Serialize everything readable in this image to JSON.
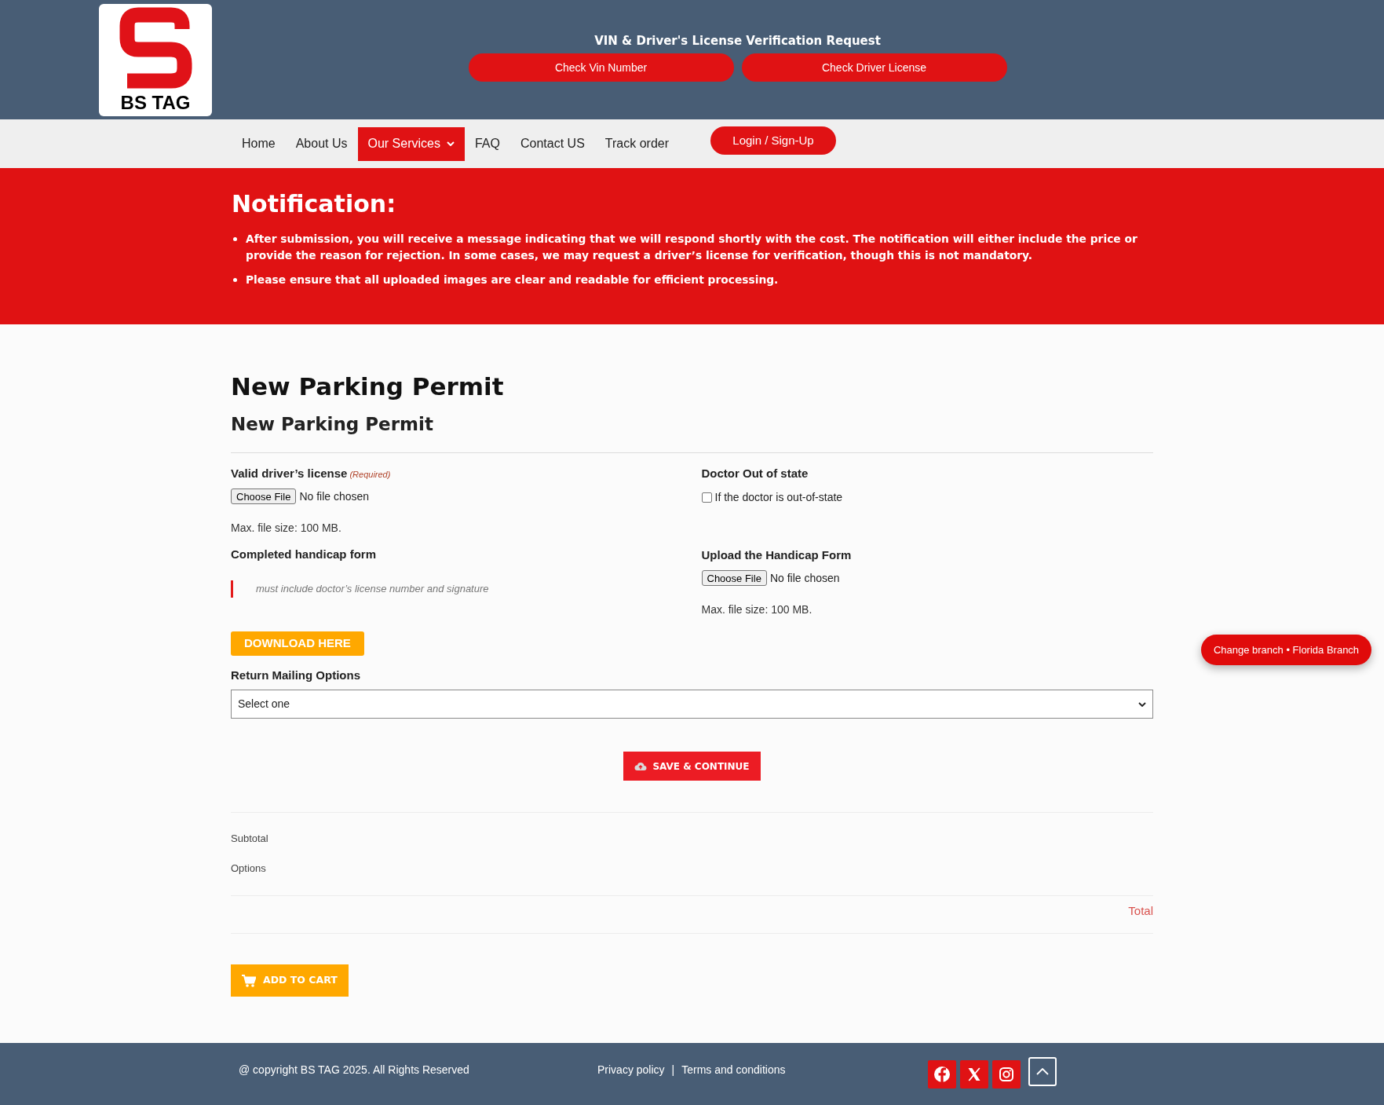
{
  "header": {
    "logo_text": "BS TAG",
    "title": "VIN & Driver's License Verification Request",
    "buttons": [
      "Check Vin Number",
      "Check Driver License"
    ]
  },
  "nav": {
    "items": [
      {
        "label": "Home",
        "selected": false,
        "dropdown": false
      },
      {
        "label": "About Us",
        "selected": false,
        "dropdown": false
      },
      {
        "label": "Our Services",
        "selected": true,
        "dropdown": true
      },
      {
        "label": "FAQ",
        "selected": false,
        "dropdown": false
      },
      {
        "label": "Contact US",
        "selected": false,
        "dropdown": false
      },
      {
        "label": "Track order",
        "selected": false,
        "dropdown": false
      }
    ],
    "login_button": "Login / Sign-Up"
  },
  "notification": {
    "title": "Notification:",
    "bullets": [
      "After submission, you will receive a message indicating that we will respond shortly with the cost. The notification will either include the price or provide the reason for rejection. In some cases, we may request a driver’s license for verification, though this is not mandatory.",
      "Please ensure that all uploaded images are clear and readable for efficient processing."
    ]
  },
  "page": {
    "title": "New Parking Permit",
    "subtitle": "New Parking Permit"
  },
  "form": {
    "columns": [
      {
        "fields": [
          {
            "kind": "file",
            "label": "Valid driver’s license",
            "required": "(Required)",
            "button": "Choose File",
            "status": "No file chosen",
            "hint": "Max. file size: 100 MB."
          },
          {
            "kind": "note",
            "label": "Completed handicap form",
            "quote": "must include doctor’s license number and signature"
          }
        ]
      },
      {
        "fields": [
          {
            "kind": "checkbox",
            "label": "Doctor Out of state",
            "option": "If the doctor is out-of-state",
            "checked": false
          },
          {
            "kind": "file",
            "label": "Upload the Handicap Form",
            "button": "Choose File",
            "status": "No file chosen",
            "hint": "Max. file size: 100 MB."
          }
        ]
      }
    ],
    "download_button": "DOWNLOAD HERE",
    "mailing": {
      "label": "Return Mailing Options",
      "value": "Select one"
    },
    "save_button": "SAVE & CONTINUE"
  },
  "summary": {
    "lines": [
      "Subtotal",
      "Options"
    ],
    "total": "Total"
  },
  "add_to_cart": "ADD TO CART",
  "branch_button": "Change branch • Florida Branch",
  "footer": {
    "copyright": "@ copyright BS TAG 2025. All Rights Reserved",
    "links": [
      "Privacy policy",
      "Terms and conditions"
    ],
    "separator": "|"
  }
}
